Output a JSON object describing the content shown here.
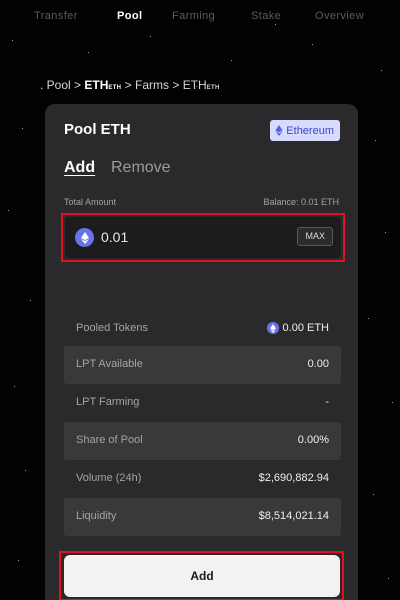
{
  "nav": {
    "items": [
      {
        "label": "Transfer",
        "active": false
      },
      {
        "label": "Pool",
        "active": true
      },
      {
        "label": "Farming",
        "active": false
      },
      {
        "label": "Stake",
        "active": false
      },
      {
        "label": "Overview",
        "active": false
      }
    ]
  },
  "breadcrumb": {
    "lead": ". Pool",
    "sep": ">",
    "token": "ETH",
    "token_sub": "ETH",
    "farms": "Farms",
    "token2": "ETH",
    "token2_sub": "ETH"
  },
  "card": {
    "title": "Pool ETH",
    "network_badge": "Ethereum",
    "tabs": {
      "add": "Add",
      "remove": "Remove",
      "active": "add"
    },
    "total_amount_label": "Total Amount",
    "balance": "Balance: 0.01 ETH",
    "amount_value": "0.01",
    "max_label": "MAX",
    "rows": [
      {
        "label": "Pooled Tokens",
        "value": "0.00 ETH",
        "icon": "eth-icon"
      },
      {
        "label": "LPT Available",
        "value": "0.00"
      },
      {
        "label": "LPT Farming",
        "value": "-"
      },
      {
        "label": "Share of Pool",
        "value": "0.00%"
      },
      {
        "label": "Volume (24h)",
        "value": "$2,690,882.94"
      },
      {
        "label": "Liquidity",
        "value": "$8,514,021.14"
      }
    ],
    "add_button": "Add"
  },
  "colors": {
    "accent": "#6a72e8",
    "highlight_outline": "#e5101f",
    "badge_bg": "#d7dbff",
    "card_bg": "#2a2a2c"
  }
}
